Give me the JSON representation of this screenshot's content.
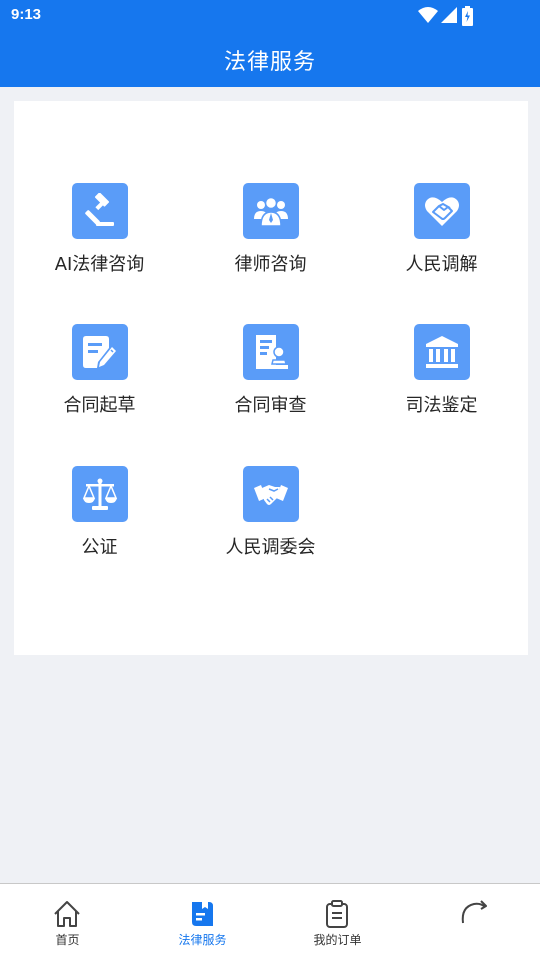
{
  "status": {
    "time": "9:13"
  },
  "header": {
    "title": "法律服务"
  },
  "services": [
    {
      "label": "AI法律咨询",
      "icon": "gavel-icon"
    },
    {
      "label": "律师咨询",
      "icon": "lawyers-icon"
    },
    {
      "label": "人民调解",
      "icon": "heart-handshake-icon"
    },
    {
      "label": "合同起草",
      "icon": "document-edit-icon"
    },
    {
      "label": "合同审查",
      "icon": "document-review-icon"
    },
    {
      "label": "司法鉴定",
      "icon": "courthouse-icon"
    },
    {
      "label": "公证",
      "icon": "scales-icon"
    },
    {
      "label": "人民调委会",
      "icon": "handshake-icon"
    }
  ],
  "tabbar": {
    "items": [
      {
        "label": "首页",
        "icon": "home-icon",
        "active": false
      },
      {
        "label": "法律服务",
        "icon": "law-book-icon",
        "active": true
      },
      {
        "label": "我的订单",
        "icon": "clipboard-icon",
        "active": false
      },
      {
        "label": "",
        "icon": "profile-icon",
        "active": false
      }
    ]
  },
  "colors": {
    "primary": "#1677ee",
    "icon_bg": "#5a9cf8",
    "page_bg": "#eff1f5"
  }
}
